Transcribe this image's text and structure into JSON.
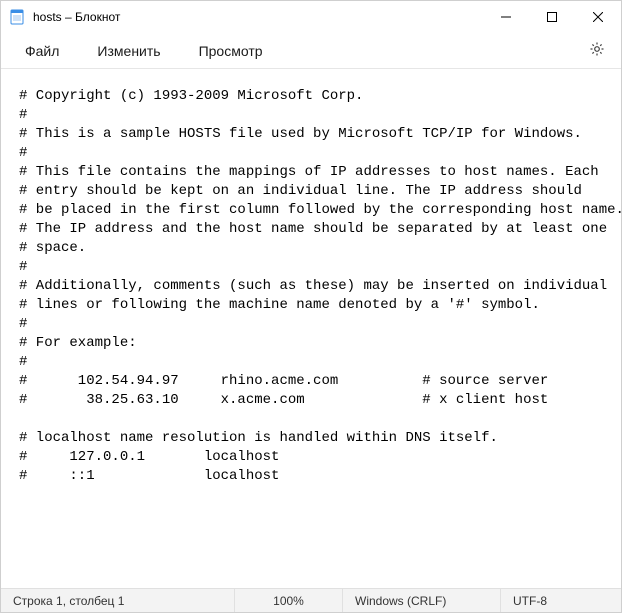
{
  "titlebar": {
    "title": "hosts – Блокнот"
  },
  "menubar": {
    "items": [
      {
        "label": "Файл"
      },
      {
        "label": "Изменить"
      },
      {
        "label": "Просмотр"
      }
    ]
  },
  "editor": {
    "content": "# Copyright (c) 1993-2009 Microsoft Corp.\n#\n# This is a sample HOSTS file used by Microsoft TCP/IP for Windows.\n#\n# This file contains the mappings of IP addresses to host names. Each\n# entry should be kept on an individual line. The IP address should\n# be placed in the first column followed by the corresponding host name.\n# The IP address and the host name should be separated by at least one\n# space.\n#\n# Additionally, comments (such as these) may be inserted on individual\n# lines or following the machine name denoted by a '#' symbol.\n#\n# For example:\n#\n#      102.54.94.97     rhino.acme.com          # source server\n#       38.25.63.10     x.acme.com              # x client host\n\n# localhost name resolution is handled within DNS itself.\n#     127.0.0.1       localhost\n#     ::1             localhost"
  },
  "statusbar": {
    "caret": "Строка 1, столбец 1",
    "zoom": "100%",
    "line_ending": "Windows (CRLF)",
    "encoding": "UTF-8"
  }
}
